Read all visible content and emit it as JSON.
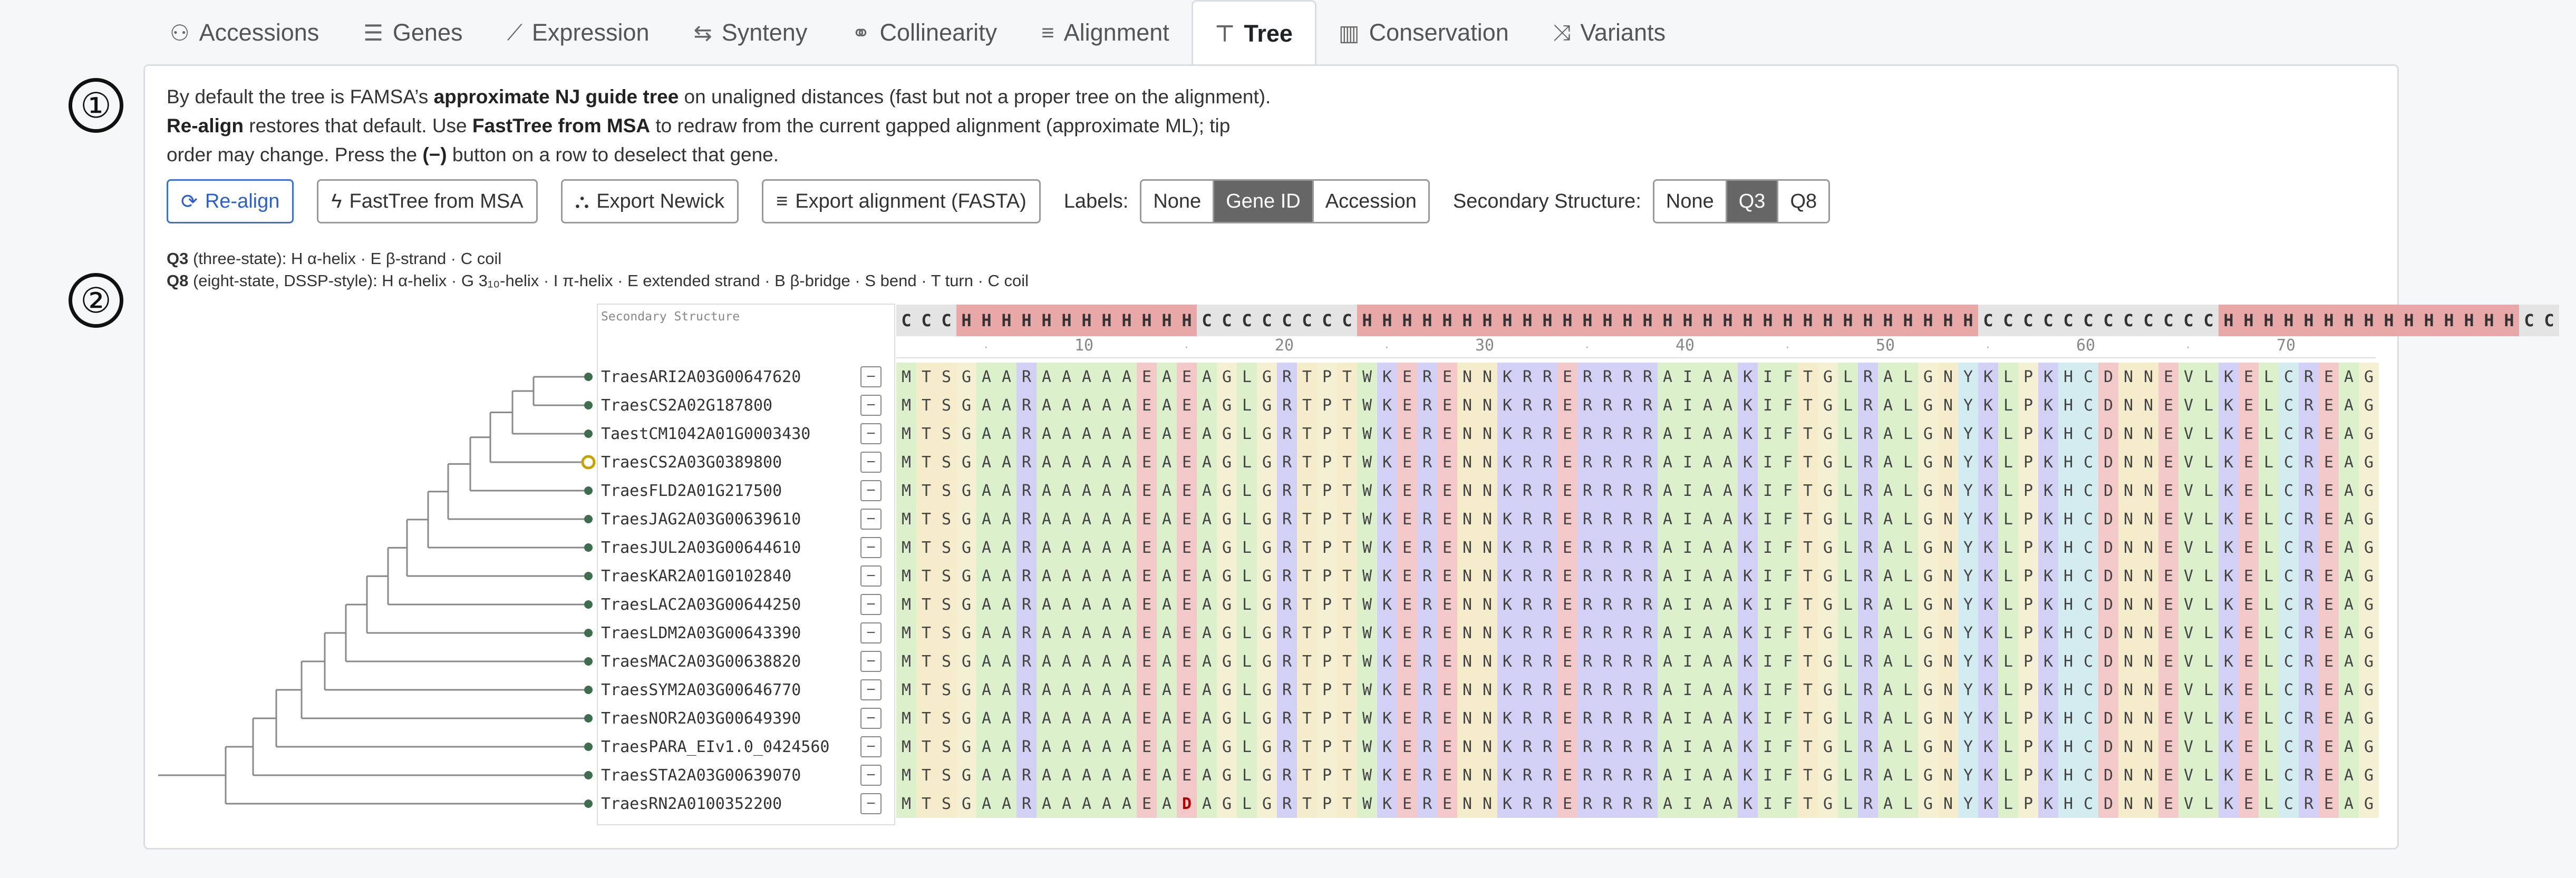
{
  "tabs": [
    {
      "icon": "accessions-icon",
      "glyph": "⚇",
      "label": "Accessions"
    },
    {
      "icon": "list-icon",
      "glyph": "☰",
      "label": "Genes"
    },
    {
      "icon": "line-chart-icon",
      "glyph": "⟋",
      "label": "Expression"
    },
    {
      "icon": "swap-icon",
      "glyph": "⇆",
      "label": "Synteny"
    },
    {
      "icon": "link-icon",
      "glyph": "⚭",
      "label": "Collinearity"
    },
    {
      "icon": "align-left-icon",
      "glyph": "≡",
      "label": "Alignment"
    },
    {
      "icon": "tree-icon",
      "glyph": "⊤",
      "label": "Tree",
      "active": true
    },
    {
      "icon": "bar-chart-icon",
      "glyph": "▥",
      "label": "Conservation"
    },
    {
      "icon": "shuffle-icon",
      "glyph": "⤨",
      "label": "Variants"
    }
  ],
  "steps": [
    "①",
    "②"
  ],
  "description": {
    "p1": "By default the tree is FAMSA’s ",
    "b1": "approximate NJ guide tree",
    "p2": " on unaligned distances (fast but not a proper tree on the alignment). ",
    "b2": "Re-align",
    "p3": " restores that default. Use ",
    "b3": "FastTree from MSA",
    "p4": " to redraw from the current gapped alignment (approximate ML); tip order may change. Press the ",
    "b4": "(−)",
    "p5": " button on a row to deselect that gene."
  },
  "toolbar": {
    "realign": "Re-align",
    "fasttree": "FastTree from MSA",
    "export_newick": "Export Newick",
    "export_fasta": "Export alignment (FASTA)",
    "labels_label": "Labels:",
    "labels_options": [
      "None",
      "Gene ID",
      "Accession"
    ],
    "labels_selected": "Gene ID",
    "ss_label": "Secondary Structure:",
    "ss_options": [
      "None",
      "Q3",
      "Q8"
    ],
    "ss_selected": "Q3"
  },
  "legend": {
    "q3_key": "Q3",
    "q3_text": " (three-state): H α-helix · E β-strand · C coil",
    "q8_key": "Q8",
    "q8_text": " (eight-state, DSSP-style): H α-helix · G 3₁₀-helix · I π-helix · E extended strand · B β-bridge · S bend · T turn · C coil"
  },
  "alignment": {
    "ss_header": "Secondary Structure",
    "ss_string": "CCCHHHHHHHHHHHHCCCCCCCCHHHHHHHHHHHHHHHHHHHHHHHHHHHHHHHCCCCCCCCCCCCHHHHHHHHHHHHHHHCC",
    "ruler": [
      "10",
      "20",
      "30",
      "40",
      "50",
      "60",
      "70"
    ],
    "deselect_glyph": "−",
    "reference_seq": "MTSGAARAAAAAEAEAGLGRTPTWKERENNKRRERRRRAIAAKIFTGLRALGNYKLPKHCDNNEVLKELCREAG",
    "rows": [
      {
        "id": "TraesARI2A03G00647620",
        "seq": "MTSGAARAAAAAEAEAGLGRTPTWKERENNKRRERRRRAIAAKIFTGLRALGNYKLPKHCDNNEVLKELCREAG"
      },
      {
        "id": "TraesCS2A02G187800",
        "seq": "MTSGAARAAAAAEAEAGLGRTPTWKERENNKRRERRRRAIAAKIFTGLRALGNYKLPKHCDNNEVLKELCREAG"
      },
      {
        "id": "TaestCM1042A01G0003430",
        "seq": "MTSGAARAAAAAEAEAGLGRTPTWKERENNKRRERRRRAIAAKIFTGLRALGNYKLPKHCDNNEVLKELCREAG"
      },
      {
        "id": "TraesCS2A03G0389800",
        "seq": "MTSGAARAAAAAEAEAGLGRTPTWKERENNKRRERRRRAIAAKIFTGLRALGNYKLPKHCDNNEVLKELCREAG",
        "highlight": true
      },
      {
        "id": "TraesFLD2A01G217500",
        "seq": "MTSGAARAAAAAEAEAGLGRTPTWKERENNKRRERRRRAIAAKIFTGLRALGNYKLPKHCDNNEVLKELCREAG"
      },
      {
        "id": "TraesJAG2A03G00639610",
        "seq": "MTSGAARAAAAAEAEAGLGRTPTWKERENNKRRERRRRAIAAKIFTGLRALGNYKLPKHCDNNEVLKELCREAG"
      },
      {
        "id": "TraesJUL2A03G00644610",
        "seq": "MTSGAARAAAAAEAEAGLGRTPTWKERENNKRRERRRRAIAAKIFTGLRALGNYKLPKHCDNNEVLKELCREAG"
      },
      {
        "id": "TraesKAR2A01G0102840",
        "seq": "MTSGAARAAAAAEAEAGLGRTPTWKERENNKRRERRRRAIAAKIFTGLRALGNYKLPKHCDNNEVLKELCREAG"
      },
      {
        "id": "TraesLAC2A03G00644250",
        "seq": "MTSGAARAAAAAEAEAGLGRTPTWKERENNKRRERRRRAIAAKIFTGLRALGNYKLPKHCDNNEVLKELCREAG"
      },
      {
        "id": "TraesLDM2A03G00643390",
        "seq": "MTSGAARAAAAAEAEAGLGRTPTWKERENNKRRERRRRAIAAKIFTGLRALGNYKLPKHCDNNEVLKELCREAG"
      },
      {
        "id": "TraesMAC2A03G00638820",
        "seq": "MTSGAARAAAAAEAEAGLGRTPTWKERENNKRRERRRRAIAAKIFTGLRALGNYKLPKHCDNNEVLKELCREAG"
      },
      {
        "id": "TraesSYM2A03G00646770",
        "seq": "MTSGAARAAAAAEAEAGLGRTPTWKERENNKRRERRRRAIAAKIFTGLRALGNYKLPKHCDNNEVLKELCREAG"
      },
      {
        "id": "TraesNOR2A03G00649390",
        "seq": "MTSGAARAAAAAEAEAGLGRTPTWKERENNKRRERRRRAIAAKIFTGLRALGNYKLPKHCDNNEVLKELCREAG"
      },
      {
        "id": "TraesPARA_EIv1.0_0424560",
        "seq": "MTSGAARAAAAAEAEAGLGRTPTWKERENNKRRERRRRAIAAKIFTGLRALGNYKLPKHCDNNEVLKELCREAG"
      },
      {
        "id": "TraesSTA2A03G00639070",
        "seq": "MTSGAARAAAAAEAEAGLGRTPTWKERENNKRRERRRRAIAAKIFTGLRALGNYKLPKHCDNNEVLKELCREAG"
      },
      {
        "id": "TraesRN2A0100352200",
        "seq": "MTSGAARAAAAAEADAGLGRTPTWKERENNKRRERRRRAIAAKIFTGLRALGNYKLPKHCDNNEVLKELCREAG"
      }
    ]
  },
  "colors": {
    "tree_line": "#888888",
    "tip_dot": "#3f6e4f",
    "tip_highlight": "#c8a000",
    "ss_H": "#e8a8a8",
    "ss_C": "#e4e4e4",
    "aa_hydrophobic": "#dcf0cc",
    "aa_positive": "#d2d0f4",
    "aa_negative": "#f2c8c8",
    "aa_polar": "#f4eccb",
    "aa_special": "#d2ecf0",
    "aa_tiny": "#f4f0d4"
  }
}
